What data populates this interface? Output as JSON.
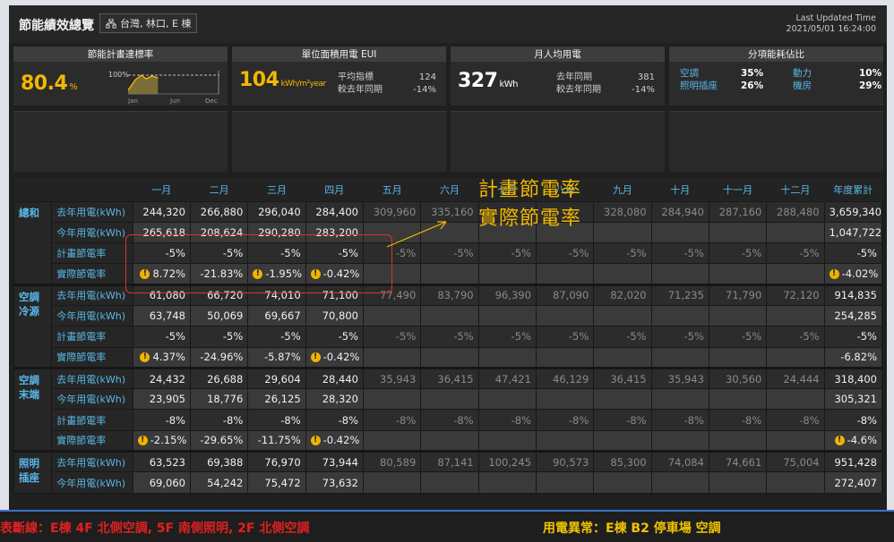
{
  "header": {
    "title": "節能績效總覽",
    "location": "台灣, 林口, E 棟",
    "updated_label": "Last Updated Time",
    "updated_time": "2021/05/01 16:24:00"
  },
  "kpi": {
    "rate": {
      "title": "節能計畫達標率",
      "value": "80.4",
      "unit": "%",
      "mini_y": "100%",
      "mini_x": [
        "Jan",
        "Jun",
        "Dec"
      ],
      "progress": 0.33
    },
    "eui": {
      "title": "單位面積用電 EUI",
      "value": "104",
      "unit": "kWh/m²year",
      "l1": "平均指標",
      "v1": "124",
      "l2": "較去年同期",
      "v2": "-14%"
    },
    "percap": {
      "title": "月人均用電",
      "value": "327",
      "unit": "kWh",
      "l1": "去年同期",
      "v1": "381",
      "l2": "較去年同期",
      "v2": "-14%"
    },
    "split": {
      "title": "分項能耗佔比",
      "items": [
        {
          "k": "空調",
          "v": "35%"
        },
        {
          "k": "動力",
          "v": "10%"
        },
        {
          "k": "照明插座",
          "v": "26%"
        },
        {
          "k": "機房",
          "v": "29%"
        }
      ]
    }
  },
  "columns": [
    "一月",
    "二月",
    "三月",
    "四月",
    "五月",
    "六月",
    "七月",
    "八月",
    "九月",
    "十月",
    "十一月",
    "十二月",
    "年度累計"
  ],
  "groups": [
    {
      "name": "總和",
      "rows": [
        {
          "label": "去年用電(kWh)",
          "cells": [
            "244,320",
            "266,880",
            "296,040",
            "284,400",
            "309,960",
            "335,160",
            "",
            "",
            "328,080",
            "284,940",
            "287,160",
            "288,480",
            "3,659,340"
          ]
        },
        {
          "label": "今年用電(kWh)",
          "cells": [
            "265,618",
            "208,624",
            "290,280",
            "283,200",
            "",
            "",
            "",
            "",
            "",
            "",
            "",
            "",
            "1,047,722"
          ]
        },
        {
          "label": "計畫節電率",
          "cells": [
            "-5%",
            "-5%",
            "-5%",
            "-5%",
            "-5%",
            "-5%",
            "-5%",
            "-5%",
            "-5%",
            "-5%",
            "-5%",
            "-5%",
            "-5%"
          ]
        },
        {
          "label": "實際節電率",
          "cells": [
            "8.72%",
            "-21.83%",
            "-1.95%",
            "-0.42%",
            "",
            "",
            "",
            "",
            "",
            "",
            "",
            "",
            "-4.02%"
          ]
        }
      ]
    },
    {
      "name": "空調冷源",
      "rows": [
        {
          "label": "去年用電(kWh)",
          "cells": [
            "61,080",
            "66,720",
            "74,010",
            "71,100",
            "77,490",
            "83,790",
            "96,390",
            "87,090",
            "82,020",
            "71,235",
            "71,790",
            "72,120",
            "914,835"
          ]
        },
        {
          "label": "今年用電(kWh)",
          "cells": [
            "63,748",
            "50,069",
            "69,667",
            "70,800",
            "",
            "",
            "",
            "",
            "",
            "",
            "",
            "",
            "254,285"
          ]
        },
        {
          "label": "計畫節電率",
          "cells": [
            "-5%",
            "-5%",
            "-5%",
            "-5%",
            "-5%",
            "-5%",
            "-5%",
            "-5%",
            "-5%",
            "-5%",
            "-5%",
            "-5%",
            "-5%"
          ]
        },
        {
          "label": "實際節電率",
          "cells": [
            "4.37%",
            "-24.96%",
            "-5.87%",
            "-0.42%",
            "",
            "",
            "",
            "",
            "",
            "",
            "",
            "",
            "-6.82%"
          ]
        }
      ]
    },
    {
      "name": "空調末端",
      "rows": [
        {
          "label": "去年用電(kWh)",
          "cells": [
            "24,432",
            "26,688",
            "29,604",
            "28,440",
            "35,943",
            "36,415",
            "47,421",
            "46,129",
            "36,415",
            "35,943",
            "30,560",
            "24,444",
            "318,400"
          ]
        },
        {
          "label": "今年用電(kWh)",
          "cells": [
            "23,905",
            "18,776",
            "26,125",
            "28,320",
            "",
            "",
            "",
            "",
            "",
            "",
            "",
            "",
            "305,321"
          ]
        },
        {
          "label": "計畫節電率",
          "cells": [
            "-8%",
            "-8%",
            "-8%",
            "-8%",
            "-8%",
            "-8%",
            "-8%",
            "-8%",
            "-8%",
            "-8%",
            "-8%",
            "-8%",
            "-8%"
          ]
        },
        {
          "label": "實際節電率",
          "cells": [
            "-2.15%",
            "-29.65%",
            "-11.75%",
            "-0.42%",
            "",
            "",
            "",
            "",
            "",
            "",
            "",
            "",
            "-4.6%"
          ]
        }
      ]
    },
    {
      "name": "照明插座",
      "rows": [
        {
          "label": "去年用電(kWh)",
          "cells": [
            "63,523",
            "69,388",
            "76,970",
            "73,944",
            "80,589",
            "87,141",
            "100,245",
            "90,573",
            "85,300",
            "74,084",
            "74,661",
            "75,004",
            "951,428"
          ]
        },
        {
          "label": "今年用電(kWh)",
          "cells": [
            "69,060",
            "54,242",
            "75,472",
            "73,632",
            "",
            "",
            "",
            "",
            "",
            "",
            "",
            "",
            "272,407"
          ]
        }
      ]
    }
  ],
  "warn_marks": [
    {
      "g": 0,
      "r": 3,
      "c": [
        0,
        2,
        3,
        12
      ]
    },
    {
      "g": 1,
      "r": 3,
      "c": [
        0,
        3
      ]
    },
    {
      "g": 2,
      "r": 3,
      "c": [
        0,
        3,
        12
      ]
    }
  ],
  "footer": {
    "left": "表斷線：E棟 4F 北側空調, 5F 南側照明, 2F 北側空調",
    "right": "用電異常：E棟 B2 停車場 空調"
  },
  "annotation": {
    "line1": "計畫節電率",
    "line2": "實際節電率"
  },
  "colors": {
    "accent": "#58b8e8",
    "highlight": "#f1b800",
    "alert": "#e02020",
    "warn": "#f0b400"
  }
}
